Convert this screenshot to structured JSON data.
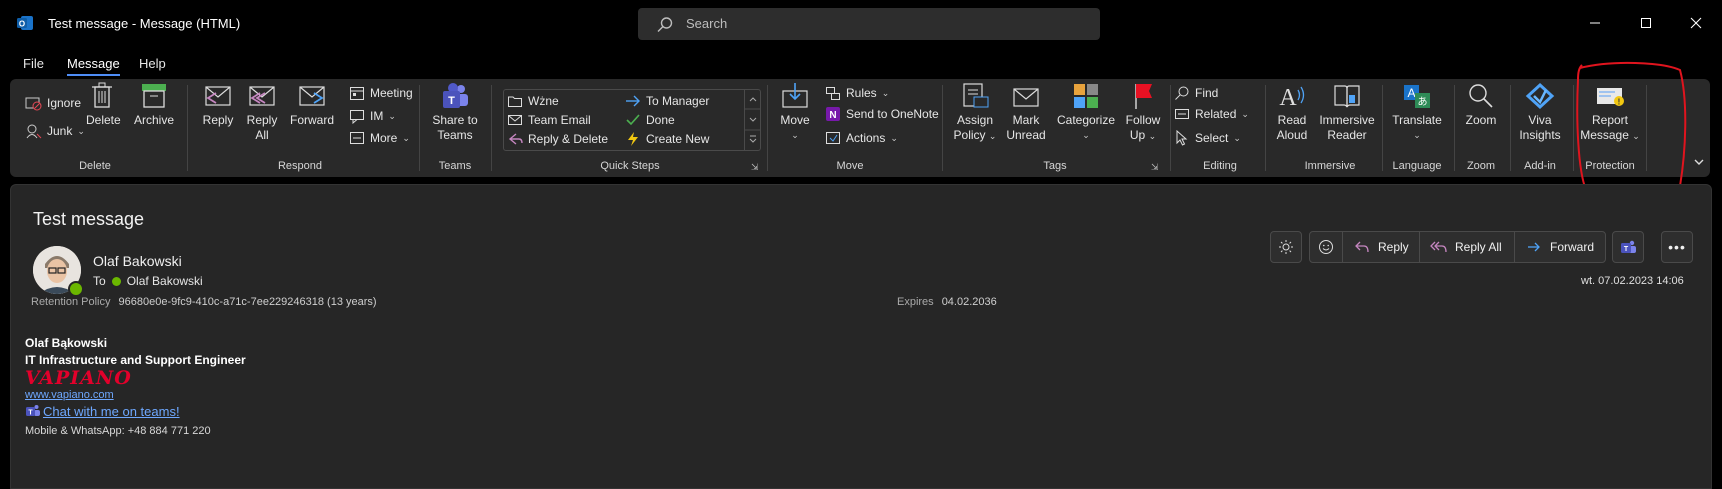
{
  "window": {
    "title": "Test message  -  Message (HTML)",
    "search_placeholder": "Search"
  },
  "tabs": [
    "File",
    "Message",
    "Help"
  ],
  "ribbon": {
    "delete_group": {
      "ignore": "Ignore",
      "junk": "Junk",
      "delete": "Delete",
      "archive": "Archive",
      "label": "Delete"
    },
    "respond_group": {
      "reply": "Reply",
      "reply_all_1": "Reply",
      "reply_all_2": "All",
      "forward": "Forward",
      "meeting": "Meeting",
      "im": "IM",
      "more": "More",
      "label": "Respond"
    },
    "teams_group": {
      "share_1": "Share to",
      "share_2": "Teams",
      "label": "Teams"
    },
    "quicksteps_group": {
      "wzne": "Wżne",
      "team_email": "Team Email",
      "reply_delete": "Reply & Delete",
      "to_manager": "To Manager",
      "done": "Done",
      "create_new": "Create New",
      "label": "Quick Steps"
    },
    "move_group": {
      "move": "Move",
      "rules": "Rules",
      "onenote": "Send to OneNote",
      "actions": "Actions",
      "label": "Move"
    },
    "tags_group": {
      "assign_1": "Assign",
      "assign_2": "Policy",
      "mark_1": "Mark",
      "mark_2": "Unread",
      "categorize": "Categorize",
      "follow_1": "Follow",
      "follow_2": "Up",
      "label": "Tags"
    },
    "editing_group": {
      "find": "Find",
      "related": "Related",
      "select": "Select",
      "label": "Editing"
    },
    "immersive_group": {
      "read_1": "Read",
      "read_2": "Aloud",
      "reader_1": "Immersive",
      "reader_2": "Reader",
      "label": "Immersive"
    },
    "language_group": {
      "translate": "Translate",
      "label": "Language"
    },
    "zoom_group": {
      "zoom": "Zoom",
      "label": "Zoom"
    },
    "addin_group": {
      "viva_1": "Viva",
      "viva_2": "Insights",
      "label": "Add-in"
    },
    "protection_group": {
      "report_1": "Report",
      "report_2": "Message",
      "label": "Protection"
    }
  },
  "message": {
    "subject": "Test message",
    "sender": "Olaf Bakowski",
    "to_label": "To",
    "recipient": "Olaf Bakowski",
    "retention_label": "Retention Policy",
    "retention_value": "96680e0e-9fc9-410c-a71c-7ee229246318 (13 years)",
    "expires_label": "Expires",
    "expires_value": "04.02.2036",
    "datetime": "wt. 07.02.2023 14:06",
    "actions": {
      "reply": "Reply",
      "reply_all": "Reply All",
      "forward": "Forward"
    }
  },
  "signature": {
    "name": "Olaf Bąkowski",
    "title": "IT Infrastructure and Support Engineer",
    "logo_text": "VAPIANO",
    "website": "www.vapiano.com",
    "teams_link": "Chat with me on teams!",
    "phone": "Mobile & WhatsApp: +48 884 771 220"
  },
  "colors": {
    "accent": "#4f8ef7",
    "annotation": "#e0141e",
    "presence": "#6bb700",
    "link": "#6ea8ff"
  }
}
